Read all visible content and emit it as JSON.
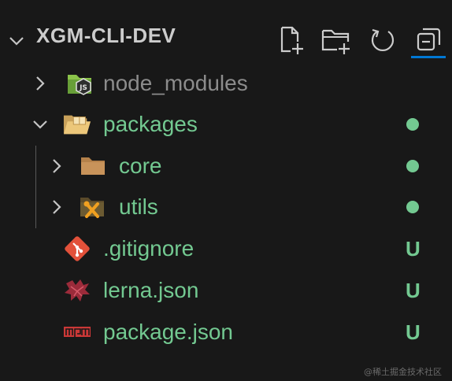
{
  "explorer": {
    "title": "XGM-CLI-DEV",
    "actions": [
      {
        "name": "new-file-icon"
      },
      {
        "name": "new-folder-icon"
      },
      {
        "name": "refresh-icon"
      },
      {
        "name": "collapse-all-icon"
      }
    ]
  },
  "tree": {
    "items": [
      {
        "label": "node_modules",
        "icon": "nodejs-folder-icon",
        "state": "collapsed",
        "status": "ignored"
      },
      {
        "label": "packages",
        "icon": "package-folder-open-icon",
        "state": "expanded",
        "status": "dot"
      },
      {
        "label": "core",
        "icon": "folder-icon",
        "state": "collapsed",
        "status": "dot"
      },
      {
        "label": "utils",
        "icon": "utils-folder-icon",
        "state": "collapsed",
        "status": "dot"
      },
      {
        "label": ".gitignore",
        "icon": "git-icon",
        "status": "U"
      },
      {
        "label": "lerna.json",
        "icon": "lerna-icon",
        "status": "U"
      },
      {
        "label": "package.json",
        "icon": "npm-icon",
        "status": "U"
      }
    ]
  },
  "colors": {
    "background": "#181818",
    "title": "#cccccc",
    "untracked": "#73c991",
    "ignored": "#8c8c8c",
    "chevron": "#c5c5c5",
    "focus_border": "#0078d4"
  },
  "watermark": "@稀土掘金技术社区"
}
